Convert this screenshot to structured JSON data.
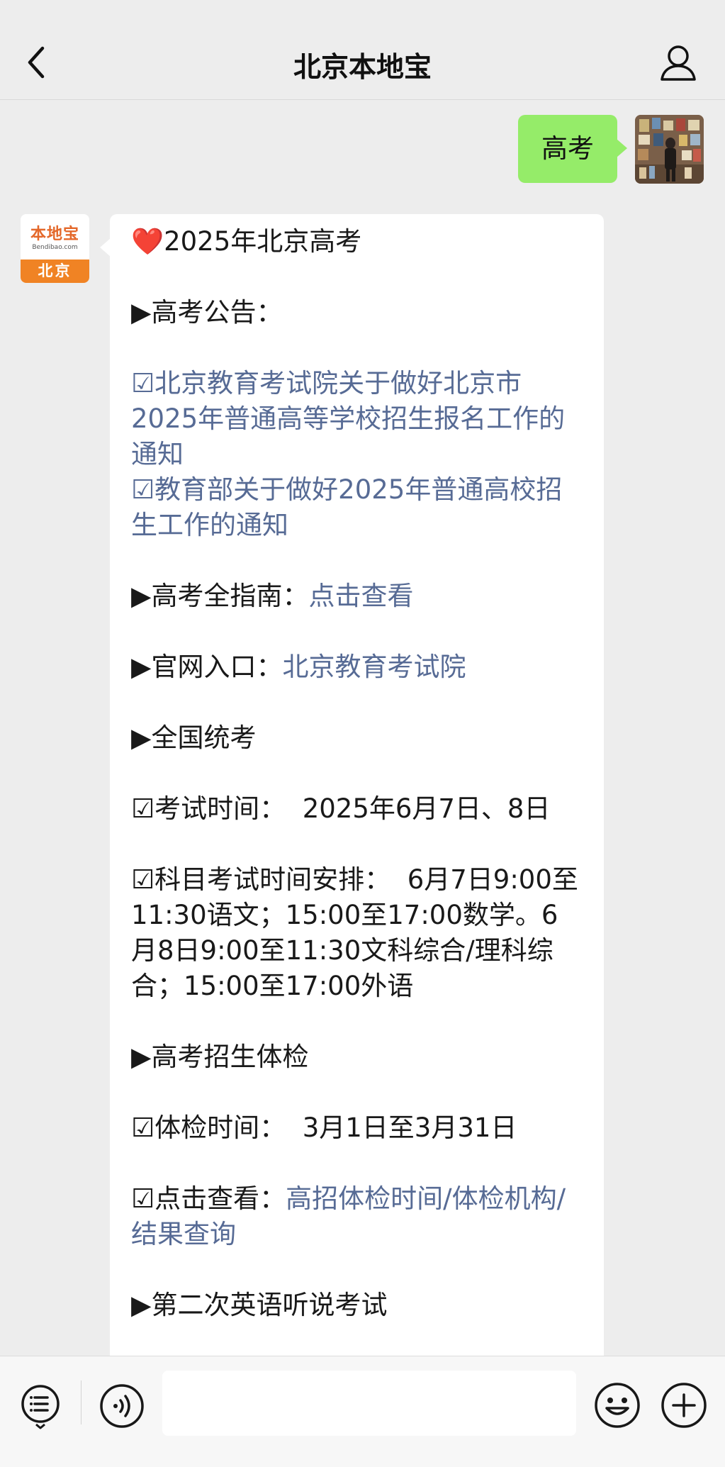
{
  "header": {
    "title": "北京本地宝"
  },
  "user_message": {
    "text": "高考"
  },
  "bot": {
    "avatar_logo": "本地宝",
    "avatar_domain": "Bendibao.com",
    "avatar_city": "北京"
  },
  "message": {
    "heart": "❤️",
    "title": "2025年北京高考",
    "s1_heading": "▶高考公告：",
    "s1_item1": "☑北京教育考试院关于做好北京市2025年普通高等学校招生报名工作的通知",
    "s1_item2": "☑教育部关于做好2025年普通高校招生工作的通知",
    "s2_label": "▶高考全指南：",
    "s2_link": "点击查看",
    "s3_label": "▶官网入口：",
    "s3_link": "北京教育考试院",
    "s4_heading": "▶全国统考",
    "s4_item1": "☑考试时间：  2025年6月7日、8日",
    "s4_item2": "☑科目考试时间安排：  6月7日9:00至11:30语文；15:00至17:00数学。6月8日9:00至11:30文科综合/理科综合；15:00至17:00外语",
    "s5_heading": "▶高考招生体检",
    "s5_item1": "☑体检时间：  3月1日至3月31日",
    "s5_item2_label": "☑点击查看：",
    "s5_item2_link": "高招体检时间/体检机构/结果查询",
    "s6_heading": "▶第二次英语听说考试"
  },
  "input": {
    "placeholder": ""
  },
  "icons": {
    "back": "chevron-left-icon",
    "profile": "person-icon",
    "menu": "list-menu-icon",
    "voice": "voice-icon",
    "emoji": "smiley-icon",
    "add": "plus-icon"
  }
}
